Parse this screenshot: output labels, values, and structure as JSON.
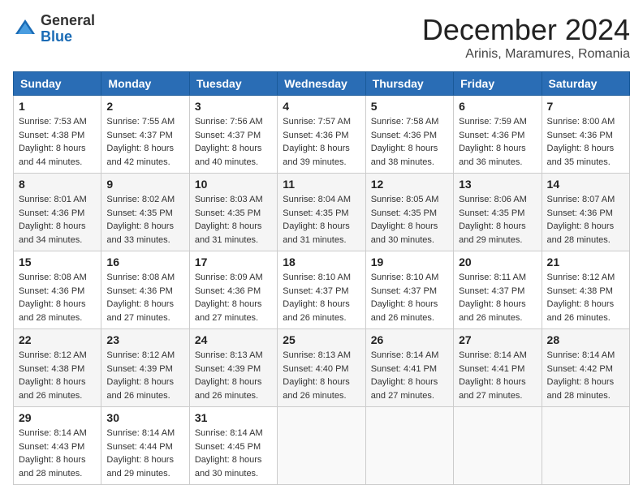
{
  "header": {
    "logo": {
      "general": "General",
      "blue": "Blue"
    },
    "title": "December 2024",
    "location": "Arinis, Maramures, Romania"
  },
  "calendar": {
    "weekdays": [
      "Sunday",
      "Monday",
      "Tuesday",
      "Wednesday",
      "Thursday",
      "Friday",
      "Saturday"
    ],
    "weeks": [
      [
        {
          "day": "1",
          "sunrise": "7:53 AM",
          "sunset": "4:38 PM",
          "daylight": "8 hours and 44 minutes."
        },
        {
          "day": "2",
          "sunrise": "7:55 AM",
          "sunset": "4:37 PM",
          "daylight": "8 hours and 42 minutes."
        },
        {
          "day": "3",
          "sunrise": "7:56 AM",
          "sunset": "4:37 PM",
          "daylight": "8 hours and 40 minutes."
        },
        {
          "day": "4",
          "sunrise": "7:57 AM",
          "sunset": "4:36 PM",
          "daylight": "8 hours and 39 minutes."
        },
        {
          "day": "5",
          "sunrise": "7:58 AM",
          "sunset": "4:36 PM",
          "daylight": "8 hours and 38 minutes."
        },
        {
          "day": "6",
          "sunrise": "7:59 AM",
          "sunset": "4:36 PM",
          "daylight": "8 hours and 36 minutes."
        },
        {
          "day": "7",
          "sunrise": "8:00 AM",
          "sunset": "4:36 PM",
          "daylight": "8 hours and 35 minutes."
        }
      ],
      [
        {
          "day": "8",
          "sunrise": "8:01 AM",
          "sunset": "4:36 PM",
          "daylight": "8 hours and 34 minutes."
        },
        {
          "day": "9",
          "sunrise": "8:02 AM",
          "sunset": "4:35 PM",
          "daylight": "8 hours and 33 minutes."
        },
        {
          "day": "10",
          "sunrise": "8:03 AM",
          "sunset": "4:35 PM",
          "daylight": "8 hours and 31 minutes."
        },
        {
          "day": "11",
          "sunrise": "8:04 AM",
          "sunset": "4:35 PM",
          "daylight": "8 hours and 31 minutes."
        },
        {
          "day": "12",
          "sunrise": "8:05 AM",
          "sunset": "4:35 PM",
          "daylight": "8 hours and 30 minutes."
        },
        {
          "day": "13",
          "sunrise": "8:06 AM",
          "sunset": "4:35 PM",
          "daylight": "8 hours and 29 minutes."
        },
        {
          "day": "14",
          "sunrise": "8:07 AM",
          "sunset": "4:36 PM",
          "daylight": "8 hours and 28 minutes."
        }
      ],
      [
        {
          "day": "15",
          "sunrise": "8:08 AM",
          "sunset": "4:36 PM",
          "daylight": "8 hours and 28 minutes."
        },
        {
          "day": "16",
          "sunrise": "8:08 AM",
          "sunset": "4:36 PM",
          "daylight": "8 hours and 27 minutes."
        },
        {
          "day": "17",
          "sunrise": "8:09 AM",
          "sunset": "4:36 PM",
          "daylight": "8 hours and 27 minutes."
        },
        {
          "day": "18",
          "sunrise": "8:10 AM",
          "sunset": "4:37 PM",
          "daylight": "8 hours and 26 minutes."
        },
        {
          "day": "19",
          "sunrise": "8:10 AM",
          "sunset": "4:37 PM",
          "daylight": "8 hours and 26 minutes."
        },
        {
          "day": "20",
          "sunrise": "8:11 AM",
          "sunset": "4:37 PM",
          "daylight": "8 hours and 26 minutes."
        },
        {
          "day": "21",
          "sunrise": "8:12 AM",
          "sunset": "4:38 PM",
          "daylight": "8 hours and 26 minutes."
        }
      ],
      [
        {
          "day": "22",
          "sunrise": "8:12 AM",
          "sunset": "4:38 PM",
          "daylight": "8 hours and 26 minutes."
        },
        {
          "day": "23",
          "sunrise": "8:12 AM",
          "sunset": "4:39 PM",
          "daylight": "8 hours and 26 minutes."
        },
        {
          "day": "24",
          "sunrise": "8:13 AM",
          "sunset": "4:39 PM",
          "daylight": "8 hours and 26 minutes."
        },
        {
          "day": "25",
          "sunrise": "8:13 AM",
          "sunset": "4:40 PM",
          "daylight": "8 hours and 26 minutes."
        },
        {
          "day": "26",
          "sunrise": "8:14 AM",
          "sunset": "4:41 PM",
          "daylight": "8 hours and 27 minutes."
        },
        {
          "day": "27",
          "sunrise": "8:14 AM",
          "sunset": "4:41 PM",
          "daylight": "8 hours and 27 minutes."
        },
        {
          "day": "28",
          "sunrise": "8:14 AM",
          "sunset": "4:42 PM",
          "daylight": "8 hours and 28 minutes."
        }
      ],
      [
        {
          "day": "29",
          "sunrise": "8:14 AM",
          "sunset": "4:43 PM",
          "daylight": "8 hours and 28 minutes."
        },
        {
          "day": "30",
          "sunrise": "8:14 AM",
          "sunset": "4:44 PM",
          "daylight": "8 hours and 29 minutes."
        },
        {
          "day": "31",
          "sunrise": "8:14 AM",
          "sunset": "4:45 PM",
          "daylight": "8 hours and 30 minutes."
        },
        null,
        null,
        null,
        null
      ]
    ]
  },
  "labels": {
    "sunrise": "Sunrise:",
    "sunset": "Sunset:",
    "daylight": "Daylight:"
  }
}
